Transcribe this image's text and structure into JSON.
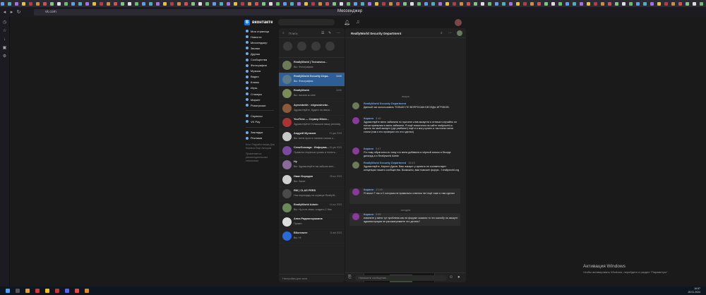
{
  "browser": {
    "url": "vk.com",
    "tab_title": "Мессенджер"
  },
  "vk": {
    "brand": "вконтакте"
  },
  "menu": [
    {
      "label": "Моя страница"
    },
    {
      "label": "Новости"
    },
    {
      "label": "Мессенджер"
    },
    {
      "label": "Звонки"
    },
    {
      "label": "Друзья"
    },
    {
      "label": "Сообщества"
    },
    {
      "label": "Фотографии"
    },
    {
      "label": "Музыка"
    },
    {
      "label": "Видео"
    },
    {
      "label": "Клипы"
    },
    {
      "label": "Игры"
    },
    {
      "label": "Стикеры"
    },
    {
      "label": "Маркет"
    },
    {
      "label": "Розыгрыши"
    }
  ],
  "menu2": [
    {
      "label": "Сервисы"
    },
    {
      "label": "VK Pay"
    }
  ],
  "menu3": [
    {
      "label": "Закладки"
    },
    {
      "label": "Реклама"
    }
  ],
  "menu_footer": "Блог  Разработчикам  Для бизнеса  Ещё  Авторам",
  "menu_footer2": "Применяются рекомендательные технологии",
  "chat_list": {
    "search_placeholder": "Поиск",
    "footer": "Настройки для чата",
    "chats": [
      {
        "name": "ReallyWorld | Техническ...",
        "time": "",
        "preview": "Вы: Фотография"
      },
      {
        "name": "ReallyWorld Security Depa...",
        "time": "16:50",
        "preview": "Вы: Фотография"
      },
      {
        "name": "ReallyWorld",
        "time": "16:50",
        "preview": "Вы: писали ко мне"
      },
      {
        "name": "Ayrumbekh · edgeuwinebe...",
        "time": "",
        "preview": "Здравствуйте, будьте на связи..."
      },
      {
        "name": "YouTime — Сервер Minec...",
        "time": "",
        "preview": "Здравствуйте! Услышали вашу реплику..."
      },
      {
        "name": "Андрей Мухачев",
        "time": "21 дек 2023",
        "preview": "Вы: меня просто лалина сноски к..."
      },
      {
        "name": "CrowGonzaga · Информа...",
        "time": "26 дек 2023",
        "preview": "Правила открытых узнать и понять..."
      },
      {
        "name": "Ну",
        "time": "",
        "preview": "Вы: Здравствуйте вы забыли мне..."
      },
      {
        "name": "Иван Бородин",
        "time": "28 окт 2023",
        "preview": "Вы: Закат"
      },
      {
        "name": "RW | CLAS PERS",
        "time": "",
        "preview": "Ник перекидку на сервере ReallyW..."
      },
      {
        "name": "ReallyWorld Admin",
        "time": "14 окт 2023",
        "preview": "Вы: Ну а не знаю, создать 1 Ник"
      },
      {
        "name": "Анна Радионоушкина",
        "time": "",
        "preview": "Привет"
      },
      {
        "name": "ВКонтакте",
        "time": "11 авг 2023",
        "preview": "Вы: Hi"
      }
    ]
  },
  "conversation": {
    "title": "ReallyWorld Security Department",
    "composer_placeholder": "Напишите сообщение...",
    "date1": "вчера",
    "date2": "сегодня",
    "messages": [
      {
        "author": "ReallyWorld Security Department",
        "time": "",
        "text": "Данный чат использовать ТОЛЬКО ПО ВОПРОСАМ БЕСЕДЫ ИГРОКОВ."
      },
      {
        "author": "Кирилл",
        "time": "9:45",
        "text": "Здравствуйте меня забанили по причине слив аккаунта я отписал случайно он потом приемлем а меня забанили. Я ещё попытался на сайте reallyworld.ru купить на свой аккаунт (где разбанит) ещё и я могу купить я так понял меня сняли (там я его проверил кто это сделал)"
      },
      {
        "author": "Кирилл",
        "time": "9:47",
        "text": "Я к тому обратился по тому что меня добавили в чёрный список в беседе дискорд-я и Reallyworld Admin"
      },
      {
        "author": "ReallyWorld Security Department",
        "time": "15:43",
        "text": "Здравствуйте, Кирилл Дуков. Ваш аккаунт у проекта не соответствует концепции нашего сообщества. Возможно, вам поможет форум - f.reallyworld.org"
      },
      {
        "author": "Кирилл",
        "time": "17:09",
        "text": "Я писал Т так я С которым не правильно ответом нет ещё тоже я там сделал"
      },
      {
        "author": "Кирилл",
        "time": "9:59",
        "text": "извините у меня тут проблема как на форуме сказали то что жалобу на аккаунт администрации не рассматриваете что делать?"
      }
    ]
  },
  "watermark": {
    "title": "Активация Windows",
    "subtitle": "Чтобы активировать Windows, перейдите в раздел \"Параметры\"."
  },
  "tray": {
    "time": "16:57",
    "date": "25.01.2024"
  },
  "colors": {
    "accent": "#71aaeb",
    "active_row": "#2d5f96",
    "bg": "#1a1a1a",
    "panel": "#222222"
  }
}
